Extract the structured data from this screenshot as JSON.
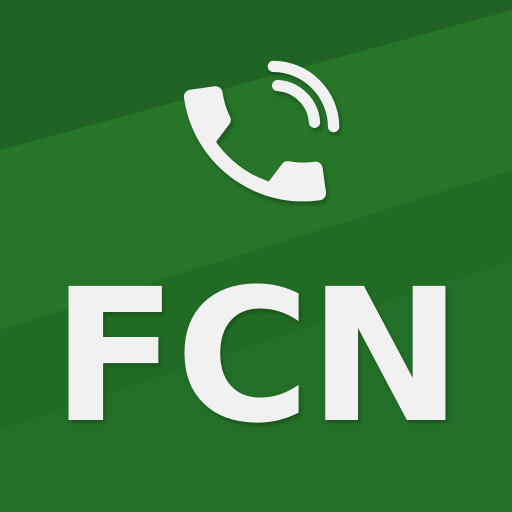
{
  "icon": {
    "brand_text": "FCN",
    "glyph": "phone-ringing-icon",
    "colors": {
      "background": "#236f26",
      "background_dark": "#1f6322",
      "background_light": "#2a7a2c",
      "foreground": "#f1f1f1"
    }
  }
}
